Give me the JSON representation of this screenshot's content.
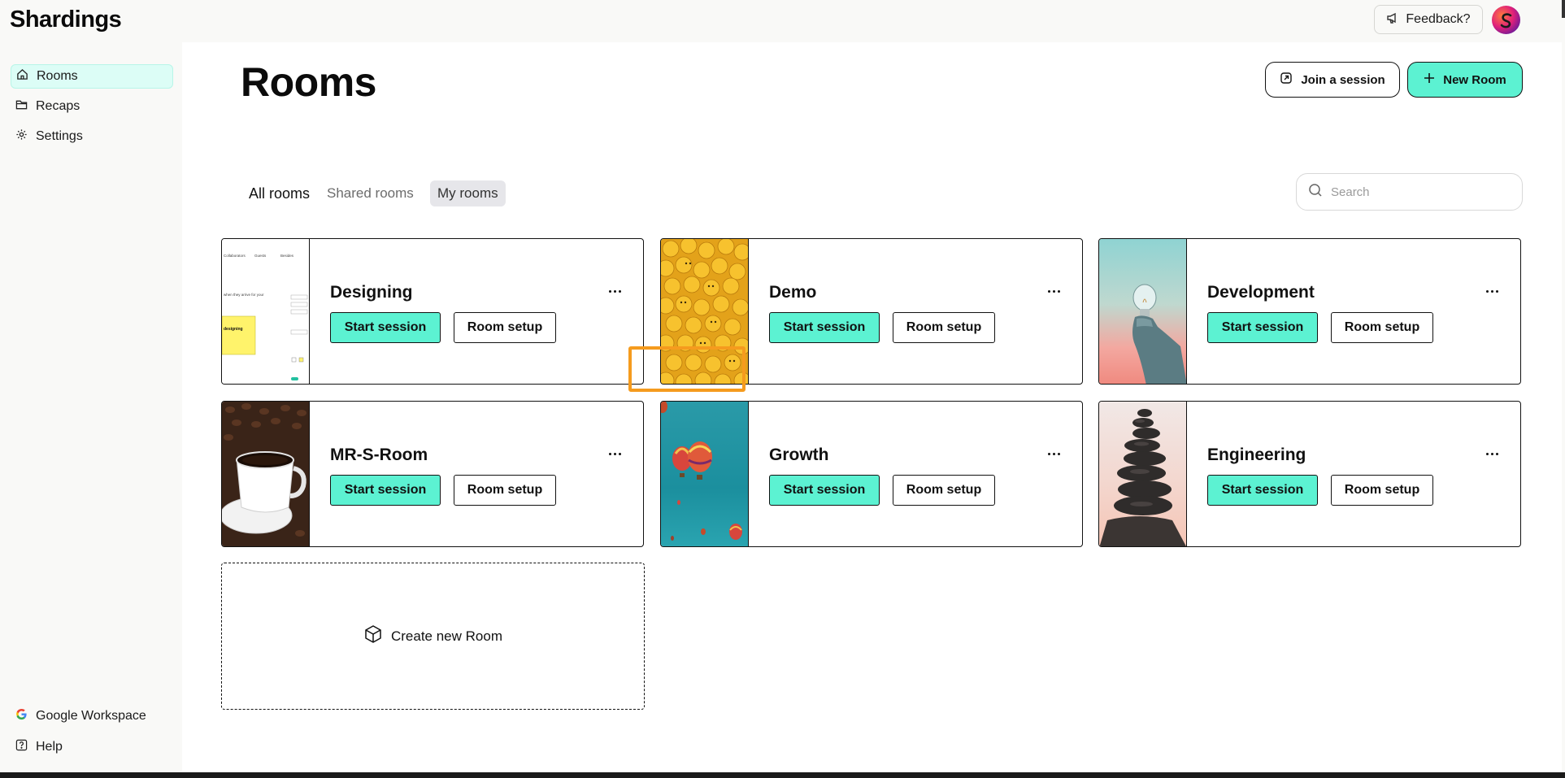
{
  "app": {
    "logo": "Shardings",
    "feedback_label": "Feedback?"
  },
  "sidebar": {
    "items": [
      {
        "label": "Rooms",
        "icon": "home-icon",
        "active": true
      },
      {
        "label": "Recaps",
        "icon": "folder-icon"
      },
      {
        "label": "Settings",
        "icon": "gear-icon"
      }
    ],
    "footer": [
      {
        "label": "Google Workspace",
        "icon": "google-icon"
      },
      {
        "label": "Help",
        "icon": "help-icon"
      }
    ]
  },
  "header": {
    "title": "Rooms",
    "join_label": "Join a session",
    "new_label": "New Room"
  },
  "tabs": [
    {
      "label": "All rooms"
    },
    {
      "label": "Shared rooms"
    },
    {
      "label": "My rooms",
      "selected": true
    }
  ],
  "search": {
    "placeholder": "Search",
    "value": ""
  },
  "rooms": [
    {
      "name": "Designing",
      "start_label": "Start session",
      "setup_label": "Room setup",
      "thumb": "screenshot-preview"
    },
    {
      "name": "Demo",
      "start_label": "Start session",
      "setup_label": "Room setup",
      "thumb": "emoji-balls"
    },
    {
      "name": "Development",
      "start_label": "Start session",
      "setup_label": "Room setup",
      "thumb": "lightbulb-hand"
    },
    {
      "name": "MR-S-Room",
      "start_label": "Start session",
      "setup_label": "Room setup",
      "thumb": "coffee-cup"
    },
    {
      "name": "Growth",
      "start_label": "Start session",
      "setup_label": "Room setup",
      "thumb": "hot-air-balloons"
    },
    {
      "name": "Engineering",
      "start_label": "Start session",
      "setup_label": "Room setup",
      "thumb": "stacked-stones"
    }
  ],
  "create_room_label": "Create new Room",
  "thumb_text": {
    "designing": {
      "nav": [
        "Collaborators",
        "Guests",
        "Besides"
      ],
      "hint": "when they arrive for your",
      "note": "designing"
    }
  },
  "colors": {
    "accent": "#5cf2d2",
    "active_nav": "#dcfdf6",
    "highlight": "#f59b1e"
  }
}
